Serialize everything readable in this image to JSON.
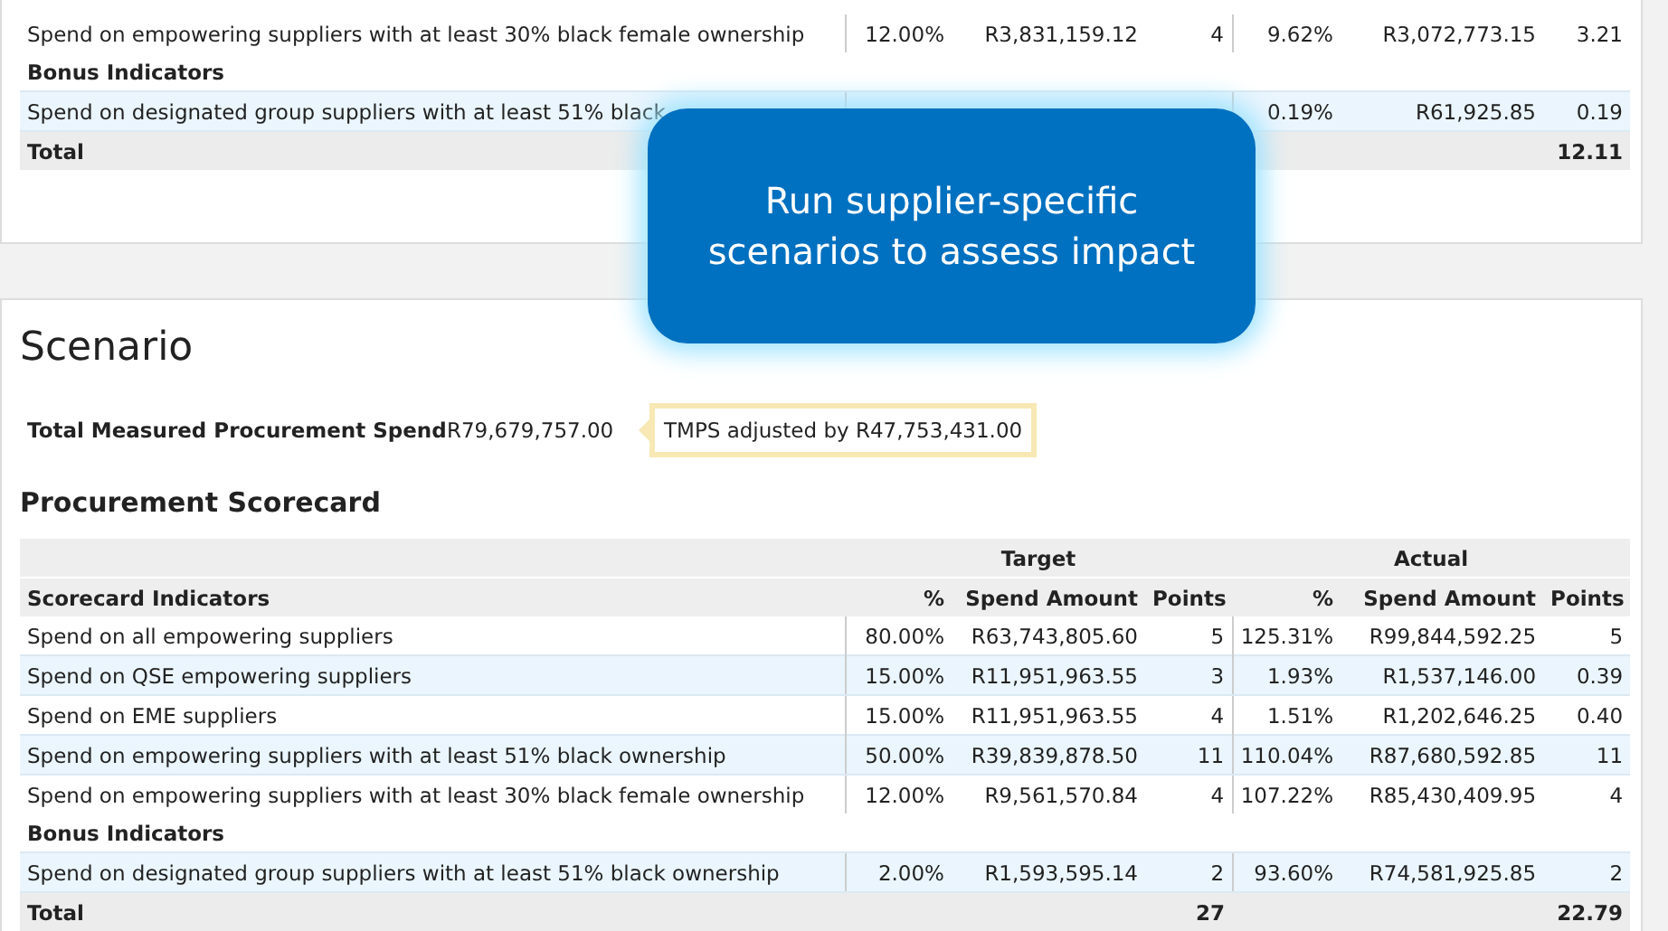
{
  "previous_scorecard": {
    "rows": [
      {
        "kind": "indicator",
        "label": "Spend on empowering suppliers with at least 30% black female ownership",
        "target_percent": "12.00%",
        "target_spend": "R3,831,159.12",
        "target_points": "4",
        "actual_percent": "9.62%",
        "actual_spend": "R3,072,773.15",
        "actual_points": "3.21"
      },
      {
        "kind": "section",
        "label": "Bonus Indicators"
      },
      {
        "kind": "indicator",
        "label": "Spend on designated group suppliers with at least 51% black",
        "actual_percent": "0.19%",
        "actual_spend": "R61,925.85",
        "actual_points": "0.19"
      },
      {
        "kind": "total",
        "label": "Total",
        "actual_points": "12.11"
      }
    ]
  },
  "callout": {
    "text": "Run supplier-specific scenarios to assess impact"
  },
  "scenario": {
    "title": "Scenario",
    "tmps_label": "Total Measured Procurement Spend",
    "tmps_value": "R79,679,757.00",
    "tmps_note": "TMPS adjusted by R47,753,431.00",
    "scorecard_title": "Procurement Scorecard",
    "group_headers": [
      "Target",
      "Actual"
    ],
    "columns": [
      "Scorecard Indicators",
      "%",
      "Spend Amount",
      "Points",
      "%",
      "Spend Amount",
      "Points"
    ],
    "rows": [
      {
        "kind": "indicator",
        "label": "Spend on all empowering suppliers",
        "target_percent": "80.00%",
        "target_spend": "R63,743,805.60",
        "target_points": "5",
        "actual_percent": "125.31%",
        "actual_spend": "R99,844,592.25",
        "actual_points": "5"
      },
      {
        "kind": "indicator",
        "label": "Spend on QSE empowering suppliers",
        "target_percent": "15.00%",
        "target_spend": "R11,951,963.55",
        "target_points": "3",
        "actual_percent": "1.93%",
        "actual_spend": "R1,537,146.00",
        "actual_points": "0.39"
      },
      {
        "kind": "indicator",
        "label": "Spend on EME suppliers",
        "target_percent": "15.00%",
        "target_spend": "R11,951,963.55",
        "target_points": "4",
        "actual_percent": "1.51%",
        "actual_spend": "R1,202,646.25",
        "actual_points": "0.40"
      },
      {
        "kind": "indicator",
        "label": "Spend on empowering suppliers with at least 51% black ownership",
        "target_percent": "50.00%",
        "target_spend": "R39,839,878.50",
        "target_points": "11",
        "actual_percent": "110.04%",
        "actual_spend": "R87,680,592.85",
        "actual_points": "11"
      },
      {
        "kind": "indicator",
        "label": "Spend on empowering suppliers with at least 30% black female ownership",
        "target_percent": "12.00%",
        "target_spend": "R9,561,570.84",
        "target_points": "4",
        "actual_percent": "107.22%",
        "actual_spend": "R85,430,409.95",
        "actual_points": "4"
      },
      {
        "kind": "section",
        "label": "Bonus Indicators"
      },
      {
        "kind": "indicator",
        "label": "Spend on designated group suppliers with at least 51% black ownership",
        "target_percent": "2.00%",
        "target_spend": "R1,593,595.14",
        "target_points": "2",
        "actual_percent": "93.60%",
        "actual_spend": "R74,581,925.85",
        "actual_points": "2"
      },
      {
        "kind": "total",
        "label": "Total",
        "target_points": "27",
        "actual_points": "22.79"
      }
    ]
  }
}
